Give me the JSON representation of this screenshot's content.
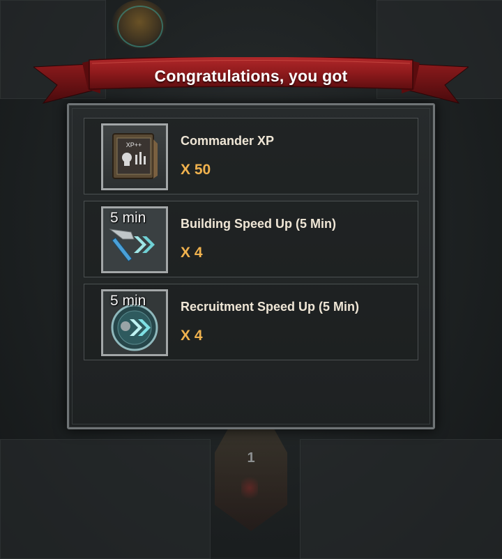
{
  "banner": {
    "title": "Congratulations, you got"
  },
  "rewards": [
    {
      "name": "Commander XP",
      "quantity": "X 50",
      "icon": "xp-book-icon",
      "icon_text": "XP++"
    },
    {
      "name": "Building Speed Up (5 Min)",
      "quantity": "X 4",
      "icon": "wrench-speedup-icon",
      "badge": "5 min"
    },
    {
      "name": "Recruitment Speed Up (5 Min)",
      "quantity": "X 4",
      "icon": "soldier-speedup-icon",
      "badge": "5 min"
    }
  ],
  "background": {
    "node_number": "1"
  },
  "colors": {
    "banner_red": "#8e1a1c",
    "quantity_orange": "#f0b24e",
    "panel_border": "#6f7476",
    "panel_bg": "#232627"
  }
}
